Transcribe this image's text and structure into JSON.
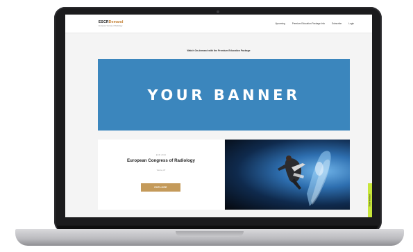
{
  "nav": {
    "logo_main_prefix": "ESCR",
    "logo_main_suffix": "Demand",
    "logo_sub": "European Society of Radiology",
    "links": [
      "Upcoming",
      "Premium Education Package Info",
      "Subscribe",
      "Login"
    ]
  },
  "headline": "Watch On-demand with the Premium Education Package",
  "banner": {
    "text": "YOUR BANNER",
    "color": "#3b86bd"
  },
  "card": {
    "kicker": "ECR 2024",
    "title": "European Congress of Radiology",
    "meta": "Vienna, AT",
    "button_label": "EXPLORE",
    "button_color": "#c49a5a"
  },
  "feedback_tab": {
    "label": "Share feedback",
    "color": "#c8e63a"
  },
  "icons": {
    "photo": "x-ray-athlete-image"
  }
}
